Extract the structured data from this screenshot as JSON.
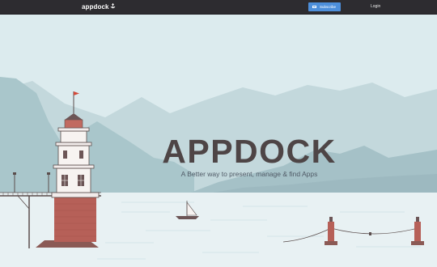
{
  "header": {
    "logo_text": "appdock",
    "subscribe_label": "Subscribe",
    "login_label": "Login"
  },
  "hero": {
    "title": "APPDOCK",
    "subtitle": "A Better way to present, manage & find Apps"
  },
  "colors": {
    "topbar": "#2d2c30",
    "accent": "#4d8fdb",
    "sky": "#dcebee",
    "water": "#e8f1f3",
    "title": "#4e4546",
    "lighthouse_red": "#b66058"
  },
  "icons": {
    "logo_mark": "anchor-icon",
    "subscribe": "mail-icon"
  }
}
